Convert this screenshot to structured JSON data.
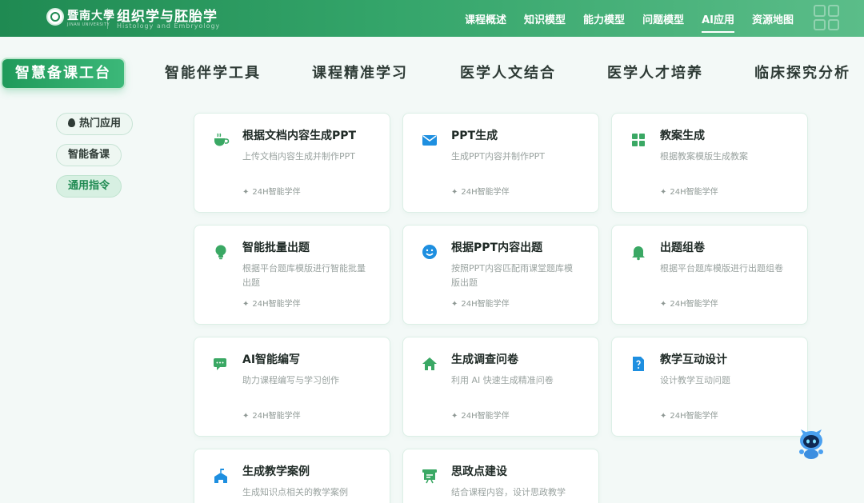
{
  "header": {
    "school_name": "暨南大學",
    "school_sub": "JINAN UNIVERSITY",
    "course_title": "组织学与胚胎学",
    "course_sub": "Histology and Embryology",
    "nav": [
      "课程概述",
      "知识模型",
      "能力模型",
      "问题模型",
      "AI应用",
      "资源地图"
    ],
    "active_nav": "AI应用"
  },
  "tabs": [
    "智慧备课工台",
    "智能伴学工具",
    "课程精准学习",
    "医学人文结合",
    "医学人才培养",
    "临床探究分析"
  ],
  "filters": [
    "热门应用",
    "智能备课",
    "通用指令"
  ],
  "footer_label": "24H智能学伴",
  "cards": [
    {
      "title": "根据文档内容生成PPT",
      "desc": "上传文档内容生成并制作PPT",
      "icon": "cup-icon"
    },
    {
      "title": "PPT生成",
      "desc": "生成PPT内容并制作PPT",
      "icon": "mail-icon"
    },
    {
      "title": "教案生成",
      "desc": "根据教案模版生成教案",
      "icon": "grid-icon"
    },
    {
      "title": "智能批量出题",
      "desc": "根据平台题库模版进行智能批量出题",
      "icon": "bulb-icon"
    },
    {
      "title": "根据PPT内容出题",
      "desc": "按照PPT内容匹配雨课堂题库模版出题",
      "icon": "smile-icon"
    },
    {
      "title": "出题组卷",
      "desc": "根据平台题库模版进行出题组卷",
      "icon": "bell-icon"
    },
    {
      "title": "AI智能编写",
      "desc": "助力课程编写与学习创作",
      "icon": "chat-icon"
    },
    {
      "title": "生成调查问卷",
      "desc": "利用 AI 快速生成精准问卷",
      "icon": "home-icon"
    },
    {
      "title": "教学互动设计",
      "desc": "设计教学互动问题",
      "icon": "doc-question-icon"
    },
    {
      "title": "生成教学案例",
      "desc": "生成知识点相关的教学案例",
      "icon": "school-icon"
    },
    {
      "title": "思政点建设",
      "desc": "结合课程内容，设计思政教学",
      "icon": "board-icon"
    }
  ],
  "colors": {
    "brand": "#1f8a52",
    "icon_green": "#3aa864",
    "icon_blue": "#1e8fe0"
  }
}
